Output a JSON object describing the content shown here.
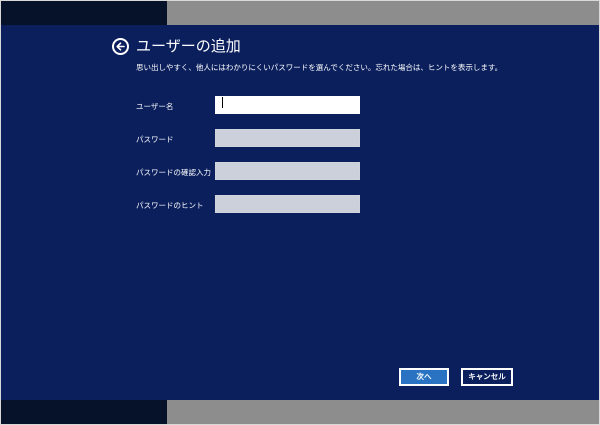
{
  "dialog": {
    "title": "ユーザーの追加",
    "subtitle": "思い出しやすく、他人にはわかりにくいパスワードを選んでください。忘れた場合は、ヒントを表示します。"
  },
  "form": {
    "username_label": "ユーザー名",
    "username_value": "",
    "password_label": "パスワード",
    "password_value": "",
    "confirm_label": "パスワードの確認入力",
    "confirm_value": "",
    "hint_label": "パスワードのヒント",
    "hint_value": ""
  },
  "buttons": {
    "next_label": "次へ",
    "cancel_label": "キャンセル"
  },
  "colors": {
    "panel": "#0b1f5d",
    "primary_button": "#2a73c3"
  }
}
